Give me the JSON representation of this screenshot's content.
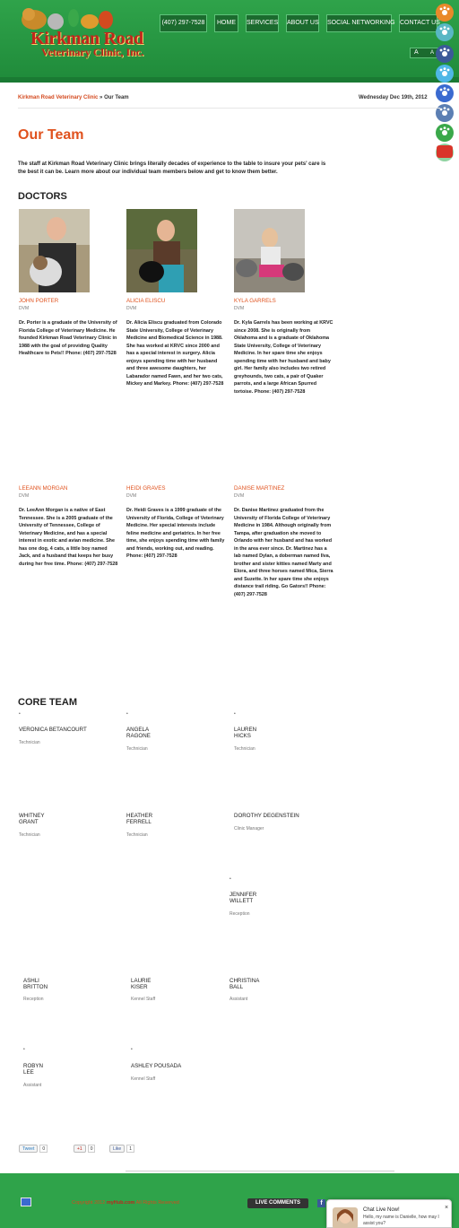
{
  "header": {
    "logo_line1": "Kirkman Road",
    "logo_line2": "Veterinary Clinic, Inc.",
    "nav": [
      "(407) 297-7528",
      "HOME",
      "SERVICES",
      "ABOUT US",
      "SOCIAL NETWORKING",
      "CONTACT US"
    ],
    "font_controls": [
      "A",
      "A"
    ]
  },
  "social_icons": [
    "rss-icon",
    "stumbleupon-icon",
    "facebook-icon",
    "twitter-icon",
    "delicious-icon",
    "digg-icon",
    "google-icon",
    "reddit-icon",
    "youtube-icon"
  ],
  "breadcrumb": {
    "home": "Kirkman Road Veterinary Clinic",
    "sep": "»",
    "current": "Our Team"
  },
  "date": "Wednesday Dec 19th, 2012",
  "page_title": "Our Team",
  "intro": "The staff at Kirkman Road Veterinary Clinic brings literally decades of experience to the table to insure your pets' care is the best it can be.  Learn more about our individual team members below and get to know them better.",
  "doctors_heading": "DOCTORS",
  "doctors": [
    {
      "name": "JOHN PORTER",
      "role": "DVM",
      "bio": "Dr. Porter is a graduate of the University of Florida College of Veterinary Medicine.  He founded Kirkman Road Veterinary Clinic in 1988 with the goal of providing Quality Healthcare to Pets!! Phone: (407) 297-7528"
    },
    {
      "name": "ALICIA ELISCU",
      "role": "DVM",
      "bio": "Dr. Alicia Eliscu graduated from Colorado State University, College of Veterinary Medicine and Biomedical Science in 1988.  She has worked at KRVC since 2000 and has a special interest in surgery.  Alicia enjoys spending time with her husband and three awesome daughters, her Labarador named Fawn, and her two cats, Mickey and Markey. Phone: (407) 297-7528"
    },
    {
      "name": "KYLA GARRELS",
      "role": "DVM",
      "bio": "Dr. Kyla Garrels has been working at KRVC since 2008.  She is originally from Oklahoma and is a graduate of Oklahoma State University, College of Veterinary Medicine.  In her spare time she enjoys spending time with her husband and baby girl.  Her family also includes two retired greyhounds, two cats, a pair of Quaker parrots, and a large African Spurred tortoise. Phone: (407) 297-7528"
    },
    {
      "name": "LEEANN MORGAN",
      "role": "DVM",
      "bio": "Dr. LeeAnn Morgan is a native of East Tennessee. She is a 2005 graduate of the University of Tennessee, College of Veterinary Medicine, and has a special interest in exotic and avian medicine. She has one dog, 4 cats, a little boy named Jack, and a husband that keeps her busy during her free time. Phone: (407) 297-7528"
    },
    {
      "name": "HEIDI GRAVES",
      "role": "DVM",
      "bio": "Dr. Heidi Graves is a 1999 graduate of the University of Florida, College of Veterinary Medicine. Her special interests include feline medicine and geriatrics. In her free time, she enjoys spending time with family and friends, working out, and reading. Phone: (407) 297-7528"
    },
    {
      "name": "DANISE MARTINEZ",
      "role": "DVM",
      "bio": "Dr. Danise Martinez graduated from the University of Florida College of Veterinary Medicine in 1984. Although originally from Tampa, after graduation she moved to Orlando with her husband and has worked in the area ever since. Dr. Martinez has a lab named Dylan, a doberman named Ilva, brother and sister kitties named Marty and Elora, and three horses named Mica, Sierra and Suzette. In her spare time she enjoys distance trail riding. Go Gators!! Phone: (407) 297-7528"
    }
  ],
  "core_heading": "CORE TEAM",
  "core_team": [
    {
      "name": "VERONICA BETANCOURT",
      "role": "Technician"
    },
    {
      "name": "ANGELA\nRAGONE",
      "role": "Technician"
    },
    {
      "name": "LAUREN\nHICKS",
      "role": "Technician"
    },
    {
      "name": "WHITNEY\nGRANT",
      "role": "Technician"
    },
    {
      "name": "HEATHER\nFERRELL",
      "role": "Technician"
    },
    {
      "name": "DOROTHY DEGENSTEIN",
      "role": "Clinic Manager"
    },
    {
      "name": "JENNIFER\nWILLETT",
      "role": "Reception"
    },
    {
      "name": "ASHLI\nBRITTON",
      "role": "Reception"
    },
    {
      "name": "LAURIE\nKISER",
      "role": "Kennel Staff"
    },
    {
      "name": "CHRISTINA\nBALL",
      "role": "Assistant"
    },
    {
      "name": "ROBYN\nLEE",
      "role": "Assistant"
    },
    {
      "name": "ASHLEY POUSADA",
      "role": "Kennel Staff"
    }
  ],
  "share": {
    "tweet": "Tweet",
    "tweet_count": "0",
    "gplus": "+1",
    "gplus_count": "0",
    "like": "Like",
    "like_count": "1"
  },
  "footer": {
    "copyright_prefix": "Copyright 2012",
    "copyright_brand": "myHub.com",
    "copyright_suffix": "All Rights Reserved",
    "live_comments": "LIVE COMMENTS",
    "fb": "f"
  },
  "chat": {
    "title": "Chat Live Now!",
    "message": "Hello, my name is Danielle, how may I assist you?",
    "close": "×"
  },
  "colors": {
    "green": "#2fa34a",
    "accent": "#e0521e",
    "nav_bg": "#1b6b2e"
  }
}
